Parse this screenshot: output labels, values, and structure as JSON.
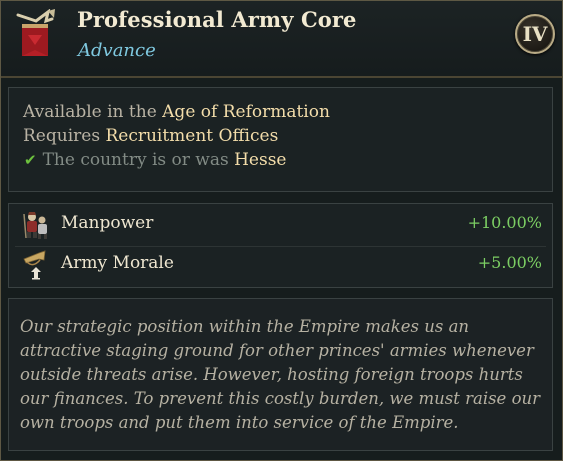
{
  "header": {
    "title": "Professional Army Core",
    "subtitle": "Advance",
    "tier_badge": "IV",
    "icon": "red-banner-trumpet-icon"
  },
  "requirements": {
    "age_prefix": "Available in the ",
    "age_value": "Age of Reformation",
    "requires_prefix": "Requires ",
    "requires_value": "Recruitment Offices",
    "country_prefix": "The country is or was ",
    "country_value": "Hesse",
    "country_status_icon": "checkmark-icon"
  },
  "modifiers": [
    {
      "label": "Manpower",
      "value": "+10.00%",
      "icon": "manpower-soldiers-icon"
    },
    {
      "label": "Army Morale",
      "value": "+5.00%",
      "icon": "army-morale-bugle-icon"
    }
  ],
  "description": "Our strategic position within the Empire makes us an attractive staging ground for other princes' armies whenever outside threats arise. However, hosting foreign troops hurts our finances. To prevent this costly burden, we must raise our own troops and put them into service of the Empire.",
  "colors": {
    "title": "#f2ead2",
    "subtitle": "#7fc9e0",
    "highlight": "#f3ddaa",
    "positive_value": "#7ccf63",
    "check": "#6dc23e",
    "background": "#161d1d"
  }
}
